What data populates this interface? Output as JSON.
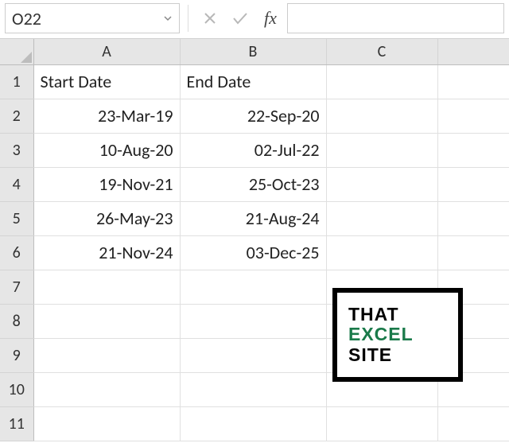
{
  "namebox": {
    "value": "O22"
  },
  "fx_label": "fx",
  "formula": {
    "value": ""
  },
  "columns": [
    "A",
    "B",
    "C"
  ],
  "visible_rows": [
    1,
    2,
    3,
    4,
    5,
    6,
    7,
    8,
    9,
    10,
    11
  ],
  "cells": {
    "A1": {
      "v": "Start Date",
      "align": "left"
    },
    "B1": {
      "v": "End Date",
      "align": "left"
    },
    "A2": {
      "v": "23-Mar-19",
      "align": "right"
    },
    "B2": {
      "v": "22-Sep-20",
      "align": "right"
    },
    "A3": {
      "v": "10-Aug-20",
      "align": "right"
    },
    "B3": {
      "v": "02-Jul-22",
      "align": "right"
    },
    "A4": {
      "v": "19-Nov-21",
      "align": "right"
    },
    "B4": {
      "v": "25-Oct-23",
      "align": "right"
    },
    "A5": {
      "v": "26-May-23",
      "align": "right"
    },
    "B5": {
      "v": "21-Aug-24",
      "align": "right"
    },
    "A6": {
      "v": "21-Nov-24",
      "align": "right"
    },
    "B6": {
      "v": "03-Dec-25",
      "align": "right"
    }
  },
  "watermark": {
    "line1": "THAT",
    "line2": "EXCEL",
    "line3": "SITE"
  },
  "chart_data": {
    "type": "table",
    "title": "",
    "columns": [
      "Start Date",
      "End Date"
    ],
    "rows": [
      [
        "23-Mar-19",
        "22-Sep-20"
      ],
      [
        "10-Aug-20",
        "02-Jul-22"
      ],
      [
        "19-Nov-21",
        "25-Oct-23"
      ],
      [
        "26-May-23",
        "21-Aug-24"
      ],
      [
        "21-Nov-24",
        "03-Dec-25"
      ]
    ]
  }
}
